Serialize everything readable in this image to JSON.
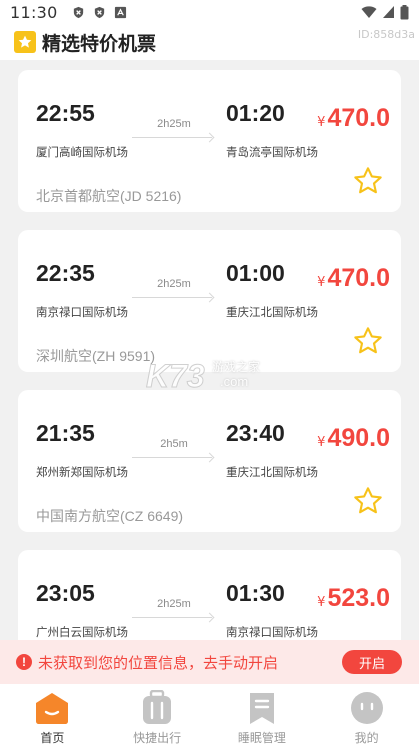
{
  "status_bar": {
    "time": "11:30",
    "left_icons": [
      "shield-icon",
      "shield-icon",
      "android-debug-icon"
    ],
    "right_icons": [
      "wifi-icon",
      "signal-icon",
      "battery-icon"
    ]
  },
  "header": {
    "title": "精选特价机票",
    "id_label": "ID:858d3a",
    "icon": "star-badge-icon"
  },
  "colors": {
    "accent": "#f2463e",
    "star": "#f7c21a",
    "tab_active": "#f5862a",
    "tab_inactive": "#c4c4c4",
    "banner_bg": "#fde9e8"
  },
  "flights": [
    {
      "dep_time": "22:55",
      "arr_time": "01:20",
      "duration": "2h25m",
      "dep_airport": "厦门高崎国际机场",
      "arr_airport": "青岛流亭国际机场",
      "airline": "北京首都航空(JD 5216)",
      "currency": "¥",
      "price": "470.0"
    },
    {
      "dep_time": "22:35",
      "arr_time": "01:00",
      "duration": "2h25m",
      "dep_airport": "南京禄口国际机场",
      "arr_airport": "重庆江北国际机场",
      "airline": "深圳航空(ZH 9591)",
      "currency": "¥",
      "price": "470.0"
    },
    {
      "dep_time": "21:35",
      "arr_time": "23:40",
      "duration": "2h5m",
      "dep_airport": "郑州新郑国际机场",
      "arr_airport": "重庆江北国际机场",
      "airline": "中国南方航空(CZ 6649)",
      "currency": "¥",
      "price": "490.0"
    },
    {
      "dep_time": "23:05",
      "arr_time": "01:30",
      "duration": "2h25m",
      "dep_airport": "广州白云国际机场",
      "arr_airport": "南京禄口国际机场",
      "airline": "",
      "currency": "¥",
      "price": "523.0"
    }
  ],
  "watermark": {
    "brand": "K73",
    "text": "游戏之家",
    "domain": ".com"
  },
  "location_banner": {
    "icon": "exclamation-icon",
    "message": "未获取到您的位置信息，去手动开启",
    "button_label": "开启"
  },
  "tabs": [
    {
      "label": "首页",
      "icon": "home-icon",
      "active": true
    },
    {
      "label": "快捷出行",
      "icon": "luggage-icon",
      "active": false
    },
    {
      "label": "睡眠管理",
      "icon": "bookmark-icon",
      "active": false
    },
    {
      "label": "我的",
      "icon": "profile-face-icon",
      "active": false
    }
  ]
}
